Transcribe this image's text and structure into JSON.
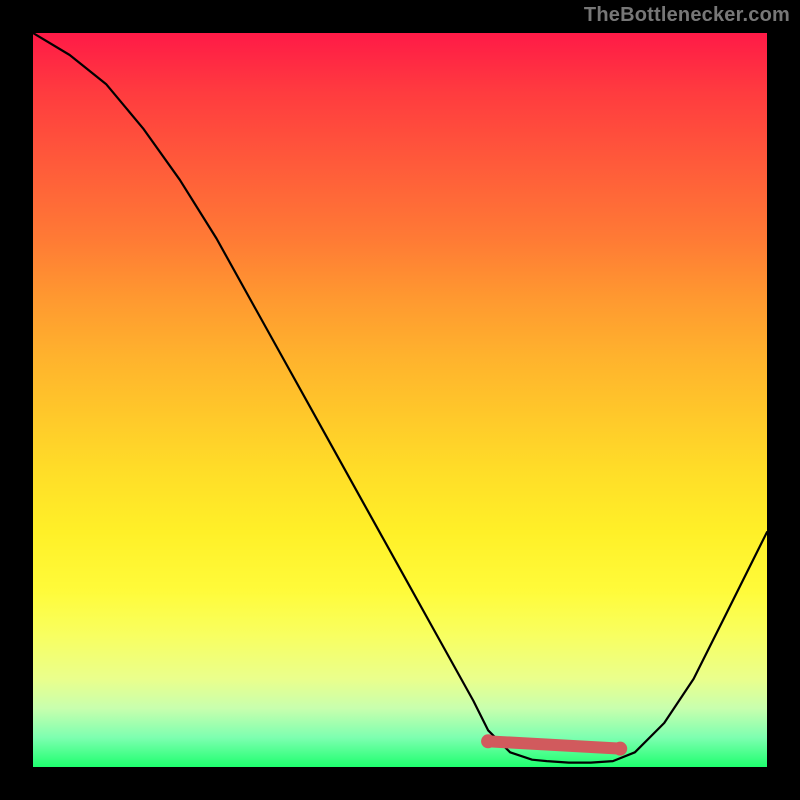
{
  "watermark": "TheBottleneсker.com",
  "colors": {
    "background": "#000000",
    "curve": "#000000",
    "marker": "#d15a5d",
    "gradient_top": "#ff1a47",
    "gradient_bottom": "#1eff6e"
  },
  "chart_data": {
    "type": "line",
    "title": "",
    "xlabel": "",
    "ylabel": "",
    "xlim": [
      0,
      100
    ],
    "ylim": [
      0,
      100
    ],
    "series": [
      {
        "name": "bottleneck-curve",
        "x": [
          0,
          5,
          10,
          15,
          20,
          25,
          30,
          35,
          40,
          45,
          50,
          55,
          60,
          62,
          65,
          68,
          70,
          73,
          76,
          79,
          82,
          86,
          90,
          94,
          98,
          100
        ],
        "y": [
          100,
          97,
          93,
          87,
          80,
          72,
          63,
          54,
          45,
          36,
          27,
          18,
          9,
          5,
          2,
          1,
          0.8,
          0.6,
          0.6,
          0.8,
          2,
          6,
          12,
          20,
          28,
          32
        ]
      }
    ],
    "markers": {
      "name": "optimal-range",
      "segment_x": [
        62,
        80
      ],
      "segment_y": [
        3.5,
        2.5
      ],
      "dots": [
        {
          "x": 62,
          "y": 3.5
        },
        {
          "x": 80,
          "y": 2.5
        }
      ]
    }
  }
}
